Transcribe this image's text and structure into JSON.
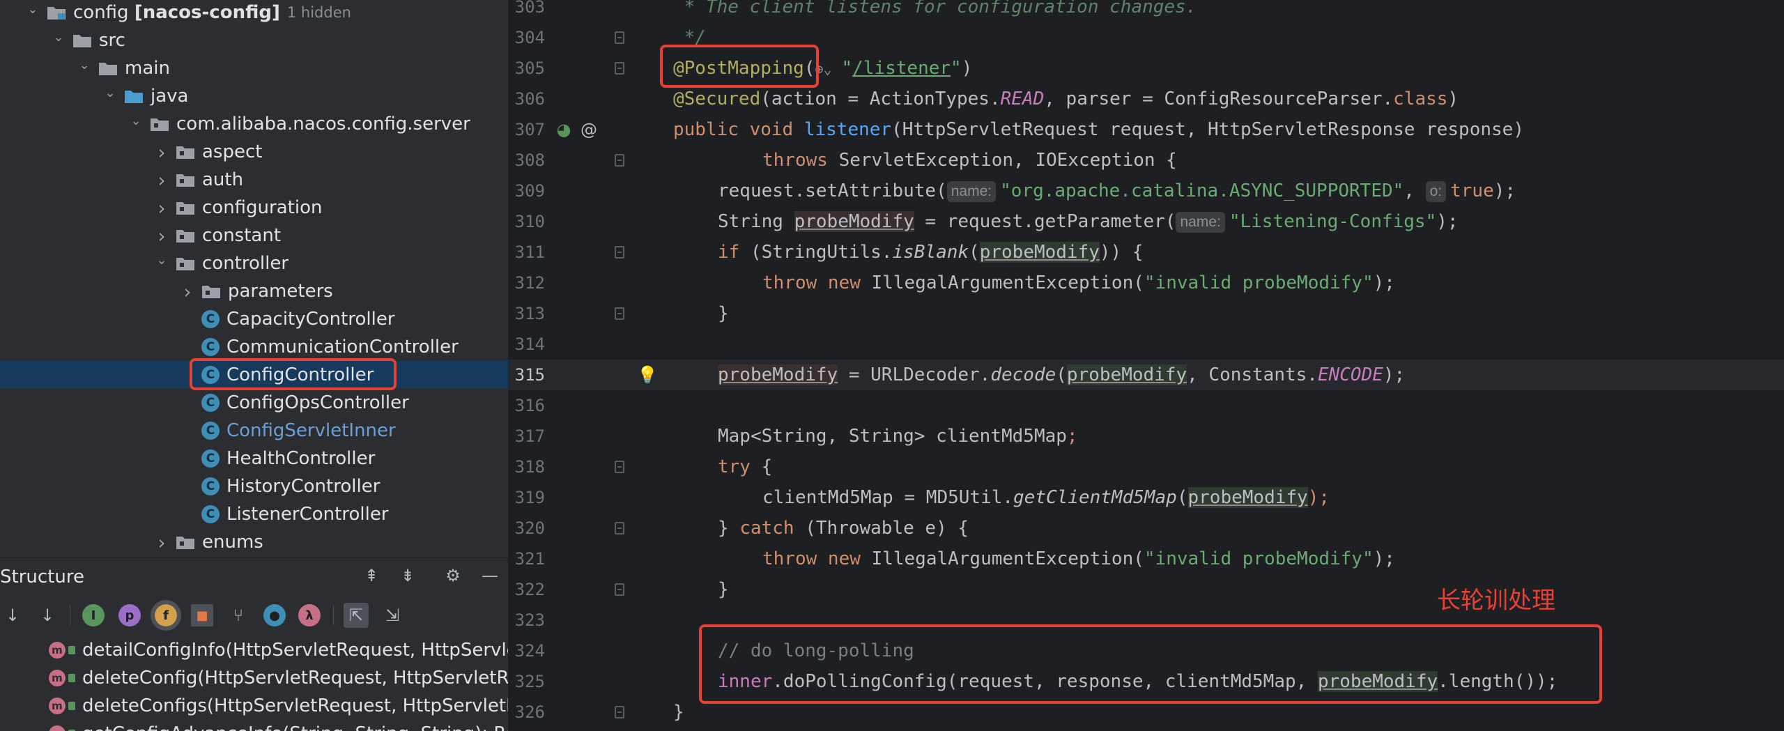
{
  "project_tree": [
    {
      "indent": 0,
      "arrow": "down",
      "icon": "module-folder",
      "label_plain": "config ",
      "label_bold": "[nacos-config]",
      "extra": "1 hidden"
    },
    {
      "indent": 1,
      "arrow": "down",
      "icon": "folder",
      "label_plain": "src"
    },
    {
      "indent": 2,
      "arrow": "down",
      "icon": "folder",
      "label_plain": "main"
    },
    {
      "indent": 3,
      "arrow": "down",
      "icon": "source-folder",
      "label_plain": "java"
    },
    {
      "indent": 4,
      "arrow": "down",
      "icon": "package-folder",
      "label_plain": "com.alibaba.nacos.config.server"
    },
    {
      "indent": 5,
      "arrow": "right",
      "icon": "package-folder",
      "label_plain": "aspect"
    },
    {
      "indent": 5,
      "arrow": "right",
      "icon": "package-folder",
      "label_plain": "auth"
    },
    {
      "indent": 5,
      "arrow": "right",
      "icon": "package-folder",
      "label_plain": "configuration"
    },
    {
      "indent": 5,
      "arrow": "right",
      "icon": "package-folder",
      "label_plain": "constant"
    },
    {
      "indent": 5,
      "arrow": "down",
      "icon": "package-folder",
      "label_plain": "controller"
    },
    {
      "indent": 6,
      "arrow": "right",
      "icon": "package-folder",
      "label_plain": "parameters"
    },
    {
      "indent": 6,
      "arrow": "none",
      "icon": "class",
      "label_plain": "CapacityController"
    },
    {
      "indent": 6,
      "arrow": "none",
      "icon": "class",
      "label_plain": "CommunicationController"
    },
    {
      "indent": 6,
      "arrow": "none",
      "icon": "class",
      "label_plain": "ConfigController",
      "selected": true
    },
    {
      "indent": 6,
      "arrow": "none",
      "icon": "class",
      "label_plain": "ConfigOpsController"
    },
    {
      "indent": 6,
      "arrow": "none",
      "icon": "class",
      "label_plain": "ConfigServletInner",
      "inner": true
    },
    {
      "indent": 6,
      "arrow": "none",
      "icon": "class",
      "label_plain": "HealthController"
    },
    {
      "indent": 6,
      "arrow": "none",
      "icon": "class",
      "label_plain": "HistoryController"
    },
    {
      "indent": 6,
      "arrow": "none",
      "icon": "class",
      "label_plain": "ListenerController"
    },
    {
      "indent": 5,
      "arrow": "right",
      "icon": "package-folder",
      "label_plain": "enums"
    }
  ],
  "class_icon_letter": "C",
  "structure": {
    "title": "Structure",
    "members": [
      "detailConfigInfo(HttpServletRequest, HttpServle",
      "deleteConfig(HttpServletRequest, HttpServletR",
      "deleteConfigs(HttpServletRequest, HttpServletI",
      "getConfigAdvanceInfo(String, String, String): Re"
    ],
    "member_icon_letter": "m",
    "toolbar_letters": {
      "p": "p",
      "f": "f",
      "lambda": "λ"
    }
  },
  "editor": {
    "lines": [
      {
        "n": "303"
      },
      {
        "n": "304"
      },
      {
        "n": "305"
      },
      {
        "n": "306"
      },
      {
        "n": "307"
      },
      {
        "n": "308"
      },
      {
        "n": "309"
      },
      {
        "n": "310"
      },
      {
        "n": "311"
      },
      {
        "n": "312"
      },
      {
        "n": "313"
      },
      {
        "n": "314"
      },
      {
        "n": "315"
      },
      {
        "n": "316"
      },
      {
        "n": "317"
      },
      {
        "n": "318"
      },
      {
        "n": "319"
      },
      {
        "n": "320"
      },
      {
        "n": "321"
      },
      {
        "n": "322"
      },
      {
        "n": "323"
      },
      {
        "n": "324"
      },
      {
        "n": "325"
      },
      {
        "n": "326"
      }
    ],
    "code": {
      "l303": " * The client listens for configuration changes.",
      "l304": " */",
      "l305_ann": "@PostMapping",
      "l305_paren": "(",
      "l305_q1": "\"",
      "l305_path": "/listener",
      "l305_q2": "\"",
      "l305_end": ")",
      "l306_ann": "@Secured",
      "l306_a": "(action = ActionTypes.",
      "l306_read": "READ",
      "l306_b": ", parser = ConfigResourceParser.",
      "l306_class": "class",
      "l306_c": ")",
      "l307_kw": "public void ",
      "l307_fn": "listener",
      "l307_rest": "(HttpServletRequest request, HttpServletResponse response)",
      "l308_kw": "throws ",
      "l308_rest": "ServletException, IOException {",
      "l309_a": "request.setAttribute(",
      "l309_hint1": "name:",
      "l309_str": "\"org.apache.catalina.ASYNC_SUPPORTED\"",
      "l309_comma": ", ",
      "l309_hint2": "o:",
      "l309_true": "true",
      "l309_end": ");",
      "l310_a": "String ",
      "l310_var": "probeModify",
      "l310_b": " = request.getParameter(",
      "l310_hint": "name:",
      "l310_str": "\"Listening-Configs\"",
      "l310_end": ");",
      "l311_kw": "if ",
      "l311_a": "(StringUtils.",
      "l311_it": "isBlank",
      "l311_b": "(",
      "l311_var": "probeModify",
      "l311_end": ")) {",
      "l312_kw": "throw new ",
      "l312_a": "IllegalArgumentException(",
      "l312_str": "\"invalid probeModify\"",
      "l312_end": ");",
      "l313": "}",
      "l315_var": "probeModify",
      "l315_a": " = URLDecoder.",
      "l315_it": "decode",
      "l315_b": "(",
      "l315_var2": "probeModify",
      "l315_c": ", Constants.",
      "l315_const": "ENCODE",
      "l315_end": ");",
      "l317_a": "Map<String, String> clientMd5Map",
      "l317_end": ";",
      "l318_kw": "try ",
      "l318_a": "{",
      "l319_a": "clientMd5Map = MD5Util.",
      "l319_it": "getClientMd5Map",
      "l319_b": "(",
      "l319_var": "probeModify",
      "l319_end": ");",
      "l320_a": "} ",
      "l320_kw": "catch ",
      "l320_b": "(Throwable e) {",
      "l321_kw": "throw new ",
      "l321_a": "IllegalArgumentException(",
      "l321_str": "\"invalid probeModify\"",
      "l321_end": ");",
      "l322": "}",
      "l324": "// do long-polling",
      "l325_fld": "inner",
      "l325_a": ".doPollingConfig(request, response, clientMd5Map, ",
      "l325_var": "probeModify",
      "l325_end": ".length());",
      "l326": "}"
    }
  },
  "annotation_text": "长轮训处理",
  "colors": {
    "highlight": "#e84134",
    "selection": "#163a5c"
  }
}
